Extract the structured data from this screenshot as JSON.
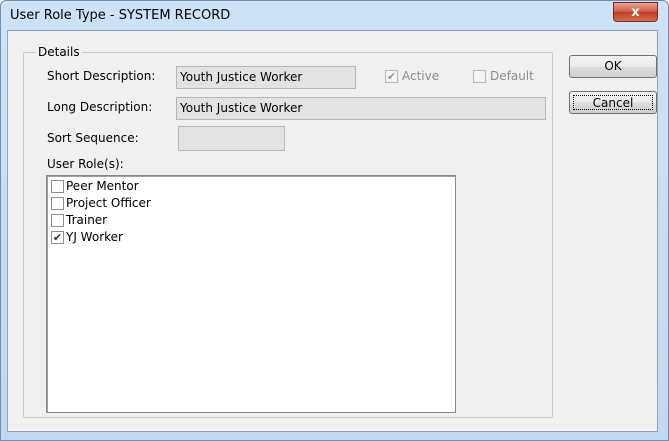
{
  "window": {
    "title": "User Role Type - SYSTEM RECORD",
    "close_glyph": "x"
  },
  "details": {
    "legend": "Details",
    "short_description": {
      "label": "Short Description:",
      "value": "Youth Justice Worker"
    },
    "long_description": {
      "label": "Long Description:",
      "value": "Youth Justice Worker"
    },
    "sort_sequence": {
      "label": "Sort Sequence:",
      "value": ""
    },
    "active": {
      "label": "Active",
      "checked": true,
      "enabled": false
    },
    "default": {
      "label": "Default",
      "checked": false,
      "enabled": false
    },
    "user_roles": {
      "label": "User Role(s):",
      "items": [
        {
          "label": "Peer Mentor",
          "checked": false
        },
        {
          "label": "Project Officer",
          "checked": false
        },
        {
          "label": "Trainer",
          "checked": false
        },
        {
          "label": "YJ Worker",
          "checked": true
        }
      ]
    }
  },
  "buttons": {
    "ok": "OK",
    "cancel": "Cancel"
  },
  "colors": {
    "title_bar": "#c7ddf3",
    "close_button": "#c9472f",
    "dialog_bg": "#f0f0f0"
  },
  "icons": {
    "check": "check-mark"
  }
}
